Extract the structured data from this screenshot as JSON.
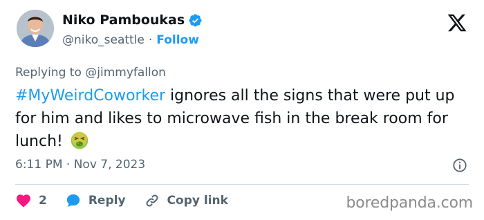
{
  "author": {
    "name": "Niko Pamboukas",
    "handle": "@niko_seattle",
    "separator": "·",
    "follow_label": "Follow"
  },
  "replying": {
    "prefix": "Replying to",
    "mention": "@jimmyfallon"
  },
  "tweet": {
    "hashtag": "#MyWeirdCoworker",
    "body": " ignores all the signs that were put up for him and likes to microwave fish in the break room for lunch! ",
    "emoji": "nauseated-face-emoji"
  },
  "meta": {
    "timestamp": "6:11 PM · Nov 7, 2023"
  },
  "actions": {
    "likes": "2",
    "reply_label": "Reply",
    "copy_label": "Copy link"
  },
  "watermark": "boredpanda.com",
  "colors": {
    "accent": "#1d9bf0",
    "like": "#f91880",
    "text": "#0f1419",
    "muted": "#536471"
  }
}
